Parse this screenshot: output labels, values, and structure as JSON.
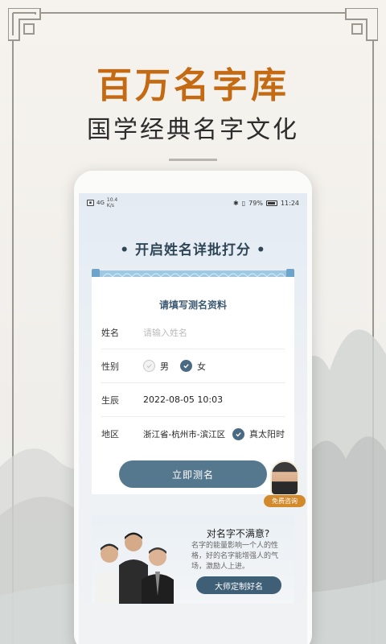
{
  "hero": {
    "title": "百万名字库",
    "subtitle": "国学经典名字文化"
  },
  "status_bar": {
    "network": "4G",
    "speed_value": "10.4",
    "speed_unit": "K/s",
    "battery": "79%",
    "time": "11:24"
  },
  "section": {
    "title": "• 开启姓名详批打分 •"
  },
  "form": {
    "title": "请填写测名资料",
    "name_label": "姓名",
    "name_placeholder": "请输入姓名",
    "gender_label": "性别",
    "gender_options": [
      "男",
      "女"
    ],
    "gender_selected": "女",
    "birth_label": "生辰",
    "birth_value": "2022-08-05 10:03",
    "region_label": "地区",
    "region_value": "浙江省-杭州市-滨江区",
    "solar_label": "真太阳时",
    "submit_label": "立即测名"
  },
  "consult": {
    "label": "免费咨询"
  },
  "promo": {
    "title": "对名字不满意?",
    "description": "名字的能量影响一个人的性格，好的名字能增强人的气场，激励人上进。",
    "button_label": "大师定制好名"
  },
  "colors": {
    "accent_orange": "#c36a12",
    "button_blue": "#56788f",
    "dark_blue": "#3f5f77"
  }
}
